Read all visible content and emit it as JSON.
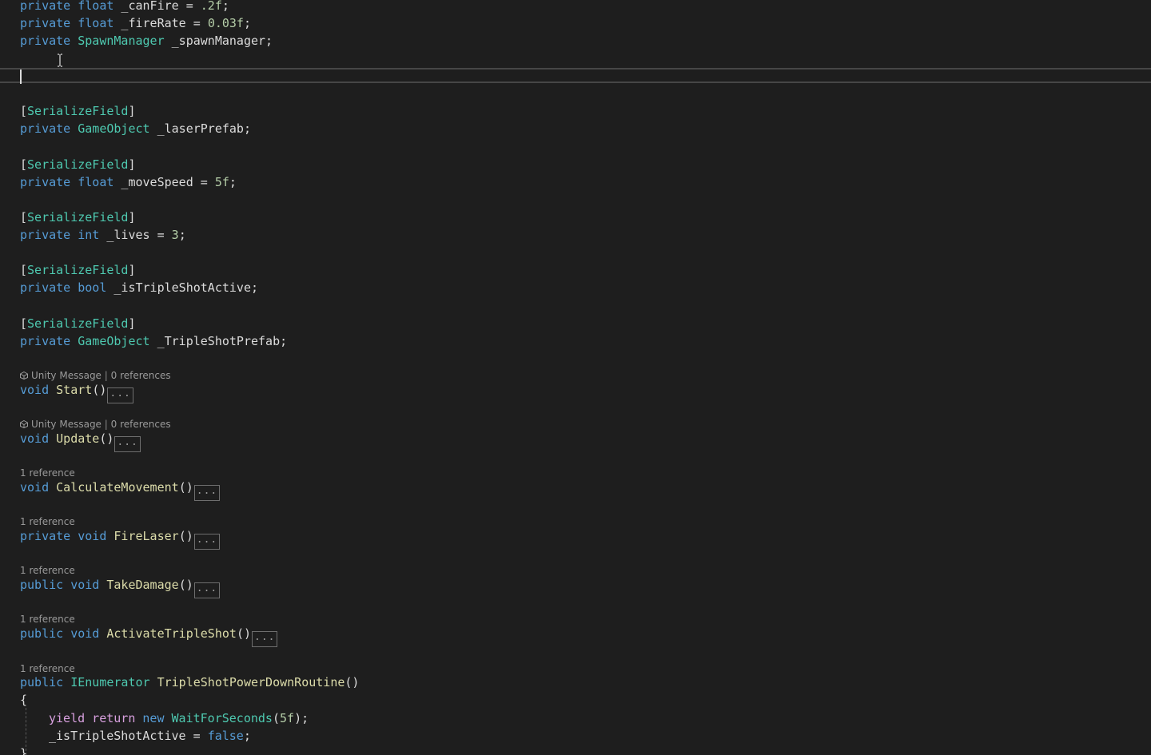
{
  "editor": {
    "fields": {
      "can_fire": {
        "access": "private",
        "type": "float",
        "name": " _canFire = ",
        "value": ".2f",
        "end": ";"
      },
      "fire_rate": {
        "access": "private",
        "type": "float",
        "name": " _fireRate = ",
        "value": "0.03f",
        "end": ";"
      },
      "spawn_manager": {
        "access": "private",
        "type": "SpawnManager",
        "name": " _spawnManager;"
      },
      "laser_prefab": {
        "attr_open": "[",
        "attr": "SerializeField",
        "attr_close": "]",
        "access": "private",
        "type": "GameObject",
        "name": " _laserPrefab;"
      },
      "move_speed": {
        "attr_open": "[",
        "attr": "SerializeField",
        "attr_close": "]",
        "access": "private",
        "type": "float",
        "name": " _moveSpeed = ",
        "value": "5f",
        "end": ";"
      },
      "lives": {
        "attr_open": "[",
        "attr": "SerializeField",
        "attr_close": "]",
        "access": "private",
        "type": "int",
        "name": " _lives = ",
        "value": "3",
        "end": ";"
      },
      "triple_shot_active": {
        "attr_open": "[",
        "attr": "SerializeField",
        "attr_close": "]",
        "access": "private",
        "type": "bool",
        "name": " _isTripleShotActive;"
      },
      "triple_shot_prefab": {
        "attr_open": "[",
        "attr": "SerializeField",
        "attr_close": "]",
        "access": "private",
        "type": "GameObject",
        "name": " _TripleShotPrefab;"
      }
    },
    "methods": {
      "start": {
        "lens_kind": "Unity Message",
        "lens_sep": "|",
        "lens_refs": "0 references",
        "kw": "void",
        "name": "Start",
        "parens": "()",
        "collapsed": "..."
      },
      "update": {
        "lens_kind": "Unity Message",
        "lens_sep": "|",
        "lens_refs": "0 references",
        "kw": "void",
        "name": "Update",
        "parens": "()",
        "collapsed": "..."
      },
      "calculate_movement": {
        "lens_refs": "1 reference",
        "kw": "void",
        "name": "CalculateMovement",
        "parens": "()",
        "collapsed": "..."
      },
      "fire_laser": {
        "lens_refs": "1 reference",
        "access": "private",
        "kw": "void",
        "name": "FireLaser",
        "parens": "()",
        "collapsed": "..."
      },
      "take_damage": {
        "lens_refs": "1 reference",
        "access": "public",
        "kw": "void",
        "name": "TakeDamage",
        "parens": "()",
        "collapsed": "..."
      },
      "activate_triple_shot": {
        "lens_refs": "1 reference",
        "access": "public",
        "kw": "void",
        "name": "ActivateTripleShot",
        "parens": "()",
        "collapsed": "..."
      },
      "triple_shot_routine": {
        "lens_refs": "1 reference",
        "access": "public",
        "type": "IEnumerator",
        "name": "TripleShotPowerDownRoutine",
        "parens": "()",
        "open_brace": "{",
        "yield_kw": "yield return",
        "new_kw": "new",
        "wait_type": "WaitForSeconds",
        "wait_open": "(",
        "wait_value": "5f",
        "wait_close": ");",
        "assign_target": "_isTripleShotActive = ",
        "assign_value": "false",
        "assign_end": ";",
        "close_brace": "}"
      }
    },
    "colors": {
      "background": "#1e1e1e",
      "keyword": "#569cd6",
      "type": "#4ec9b0",
      "method": "#dcdcaa",
      "number": "#b5cea8",
      "control": "#d8a0df",
      "text": "#dcdcdc",
      "codelens": "#9a9a9a"
    }
  }
}
